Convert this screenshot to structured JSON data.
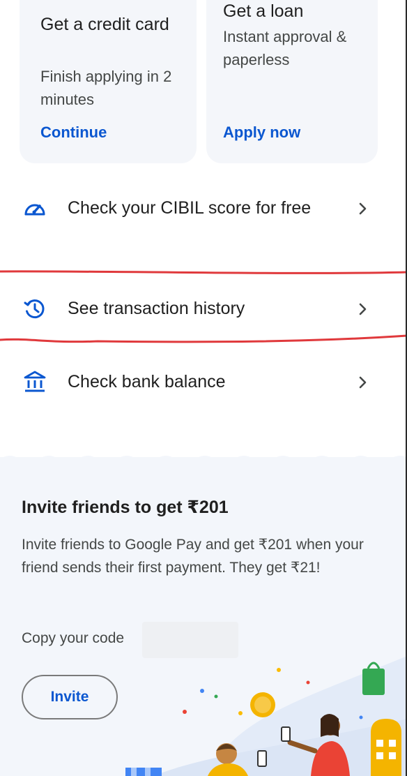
{
  "cards": {
    "credit": {
      "title": "Get a credit card",
      "subtitle": "Finish applying in 2 minutes",
      "action": "Continue"
    },
    "loan": {
      "title": "Get a loan",
      "subtitle": "Instant approval & paperless",
      "action": "Apply now"
    }
  },
  "rows": {
    "cibil": {
      "label": "Check your CIBIL score for free",
      "icon": "speedometer-icon"
    },
    "transactions": {
      "label": "See transaction history",
      "icon": "history-icon"
    },
    "bank": {
      "label": "Check bank balance",
      "icon": "bank-icon"
    }
  },
  "invite": {
    "title": "Invite friends to get ₹201",
    "description": "Invite friends to Google Pay and get ₹201 when your friend sends their first payment. They get ₹21!",
    "code_label": "Copy your code",
    "button": "Invite"
  },
  "colors": {
    "accent": "#0b57d0",
    "highlight": "#e0393c",
    "card_bg": "#f4f6fa",
    "invite_bg": "#f3f6fb"
  }
}
